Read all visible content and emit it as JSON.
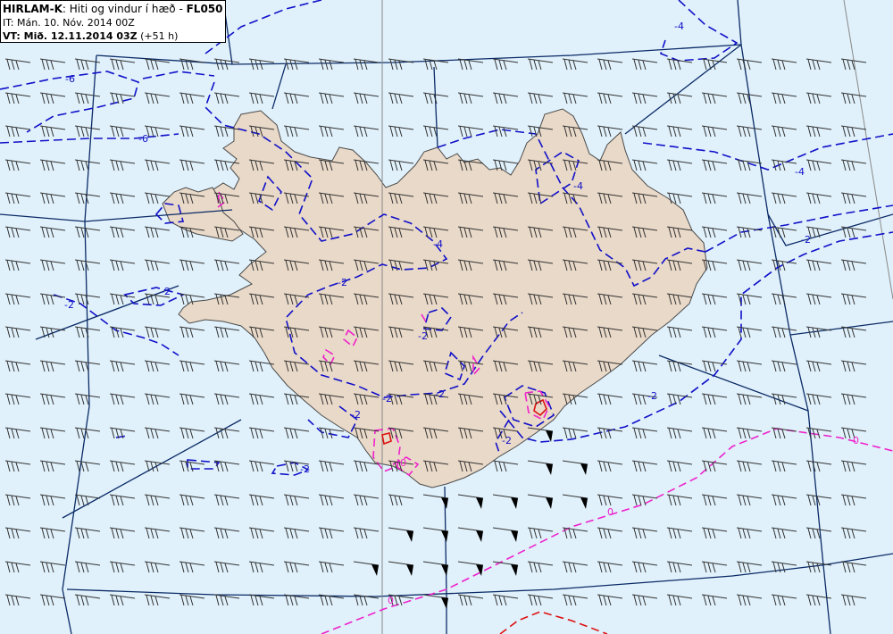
{
  "header": {
    "model": "HIRLAM-K",
    "separator": ": ",
    "description": "Hiti og vindur í hæð - ",
    "level": "FL050",
    "init_time": "IT: Mán. 10. Nóv. 2014 00Z",
    "valid_label": "VT: Mið. 12.11.2014 03Z",
    "valid_offset": " (+51 h)"
  },
  "colors": {
    "sea": "#e0f1fb",
    "land": "#e9d9c8",
    "coast": "#4a4a4a",
    "grid": "#0a2a66",
    "isotherm_neg": "#1010c8",
    "isotherm_zero": "#ee22cc",
    "isotherm_pos": "#dd1111",
    "barb": "#333333"
  },
  "isotherm_labels": [
    "-6",
    "-6",
    "-4",
    "-4",
    "-4",
    "-4",
    "-2",
    "-2",
    "-2",
    "-2",
    "-2",
    "-2",
    "-2",
    "-2",
    "-2",
    "-2",
    "-2",
    "0",
    "0",
    "0",
    "0"
  ],
  "wind": {
    "direction_deg": 290,
    "barb_symbol": "wind-barb"
  }
}
